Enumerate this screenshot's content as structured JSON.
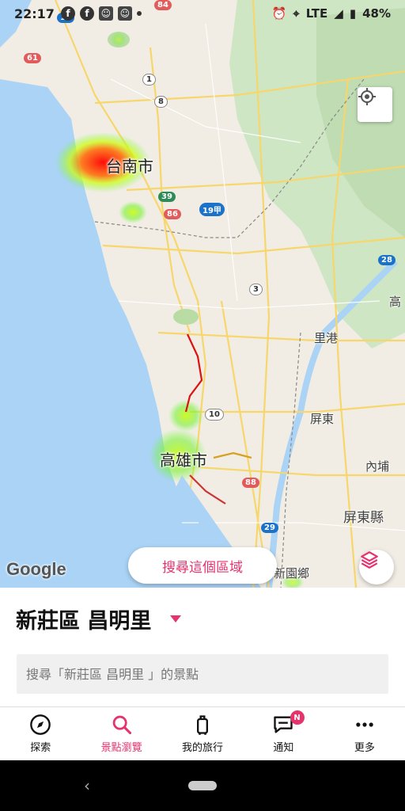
{
  "status_bar": {
    "time": "22:17",
    "network": "LTE",
    "battery": "48%"
  },
  "map": {
    "cities": [
      {
        "name": "台南市"
      },
      {
        "name": "高雄市"
      }
    ],
    "places": [
      "里港",
      "屏東",
      "內埔",
      "屏東縣",
      "新園鄉",
      "高"
    ],
    "road_shields": [
      "61",
      "1",
      "8",
      "39",
      "86",
      "19甲",
      "3",
      "28",
      "10",
      "88",
      "29",
      "84",
      "17"
    ],
    "attribution": "Google",
    "search_area_label": "搜尋這個區域",
    "locate_icon": "crosshair-icon",
    "layers_icon": "layers-icon"
  },
  "panel": {
    "region": "新莊區 昌明里",
    "search_placeholder": "搜尋「新莊區 昌明里 」的景點"
  },
  "nav": {
    "items": [
      {
        "label": "探索",
        "icon": "compass-icon",
        "active": false
      },
      {
        "label": "景點瀏覽",
        "icon": "search-icon",
        "active": true
      },
      {
        "label": "我的旅行",
        "icon": "luggage-icon",
        "active": false
      },
      {
        "label": "通知",
        "icon": "chat-icon",
        "active": false,
        "badge": "N"
      },
      {
        "label": "更多",
        "icon": "more-icon",
        "active": false
      }
    ]
  },
  "colors": {
    "accent": "#e6336e",
    "sea": "#aad3f5",
    "land": "#f1ede4"
  }
}
